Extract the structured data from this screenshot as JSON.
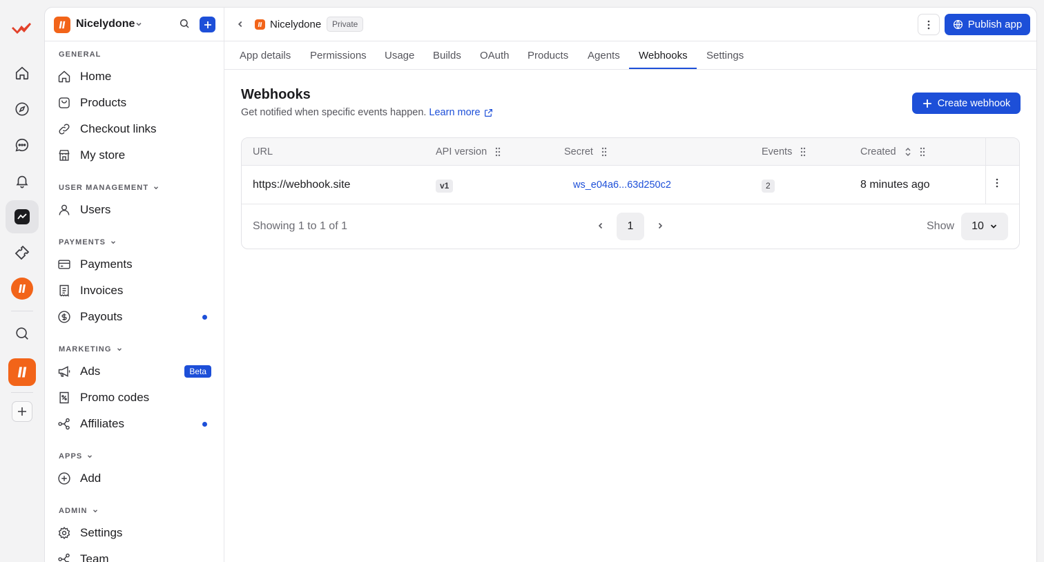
{
  "rail": {
    "items": [
      {
        "icon": "brand-logo-icon"
      },
      {
        "icon": "home-icon"
      },
      {
        "icon": "compass-icon"
      },
      {
        "icon": "chat-icon"
      },
      {
        "icon": "bell-icon"
      },
      {
        "icon": "dashboard-icon"
      },
      {
        "icon": "ticket-icon"
      },
      {
        "icon": "company-logo-icon"
      },
      {
        "icon": "search-icon"
      },
      {
        "icon": "app-logo-icon"
      },
      {
        "icon": "plus-icon"
      }
    ]
  },
  "sidebar": {
    "workspace_name": "Nicelydone",
    "general_title": "GENERAL",
    "general_items": [
      {
        "label": "Home",
        "icon": "home-icon"
      },
      {
        "label": "Products",
        "icon": "bag-icon"
      },
      {
        "label": "Checkout links",
        "icon": "link-icon"
      },
      {
        "label": "My store",
        "icon": "store-icon"
      }
    ],
    "user_management_title": "USER MANAGEMENT",
    "user_items": [
      {
        "label": "Users",
        "icon": "user-icon"
      }
    ],
    "payments_title": "PAYMENTS",
    "payments_items": [
      {
        "label": "Payments",
        "icon": "credit-card-icon"
      },
      {
        "label": "Invoices",
        "icon": "receipt-icon"
      },
      {
        "label": "Payouts",
        "icon": "dollar-circle-icon",
        "dot": true
      }
    ],
    "marketing_title": "MARKETING",
    "marketing_items": [
      {
        "label": "Ads",
        "icon": "megaphone-icon",
        "badge": "Beta"
      },
      {
        "label": "Promo codes",
        "icon": "percent-icon"
      },
      {
        "label": "Affiliates",
        "icon": "share-icon",
        "dot": true
      }
    ],
    "apps_title": "APPS",
    "apps_items": [
      {
        "label": "Add",
        "icon": "plus-circle-icon"
      }
    ],
    "admin_title": "ADMIN",
    "admin_items": [
      {
        "label": "Settings",
        "icon": "gear-icon"
      },
      {
        "label": "Team",
        "icon": "team-icon"
      }
    ]
  },
  "topbar": {
    "app_name": "Nicelydone",
    "visibility_badge": "Private",
    "publish_label": "Publish app"
  },
  "tabs": [
    {
      "label": "App details"
    },
    {
      "label": "Permissions"
    },
    {
      "label": "Usage"
    },
    {
      "label": "Builds"
    },
    {
      "label": "OAuth"
    },
    {
      "label": "Products"
    },
    {
      "label": "Agents"
    },
    {
      "label": "Webhooks",
      "active": true
    },
    {
      "label": "Settings"
    }
  ],
  "main": {
    "title": "Webhooks",
    "subtitle": "Get notified when specific events happen.",
    "learn_more": "Learn more",
    "create_label": "Create webhook"
  },
  "table": {
    "columns": [
      "URL",
      "API version",
      "Secret",
      "Events",
      "Created"
    ],
    "rows": [
      {
        "url": "https://webhook.site",
        "api_version": "v1",
        "secret": "ws_e04a6...63d250c2",
        "events": "2",
        "created": "8 minutes ago"
      }
    ],
    "showing": "Showing 1 to 1 of 1",
    "page": "1",
    "show_label": "Show",
    "page_size": "10"
  },
  "colors": {
    "accent": "#1d4fd8",
    "brand_orange": "#f26419"
  }
}
